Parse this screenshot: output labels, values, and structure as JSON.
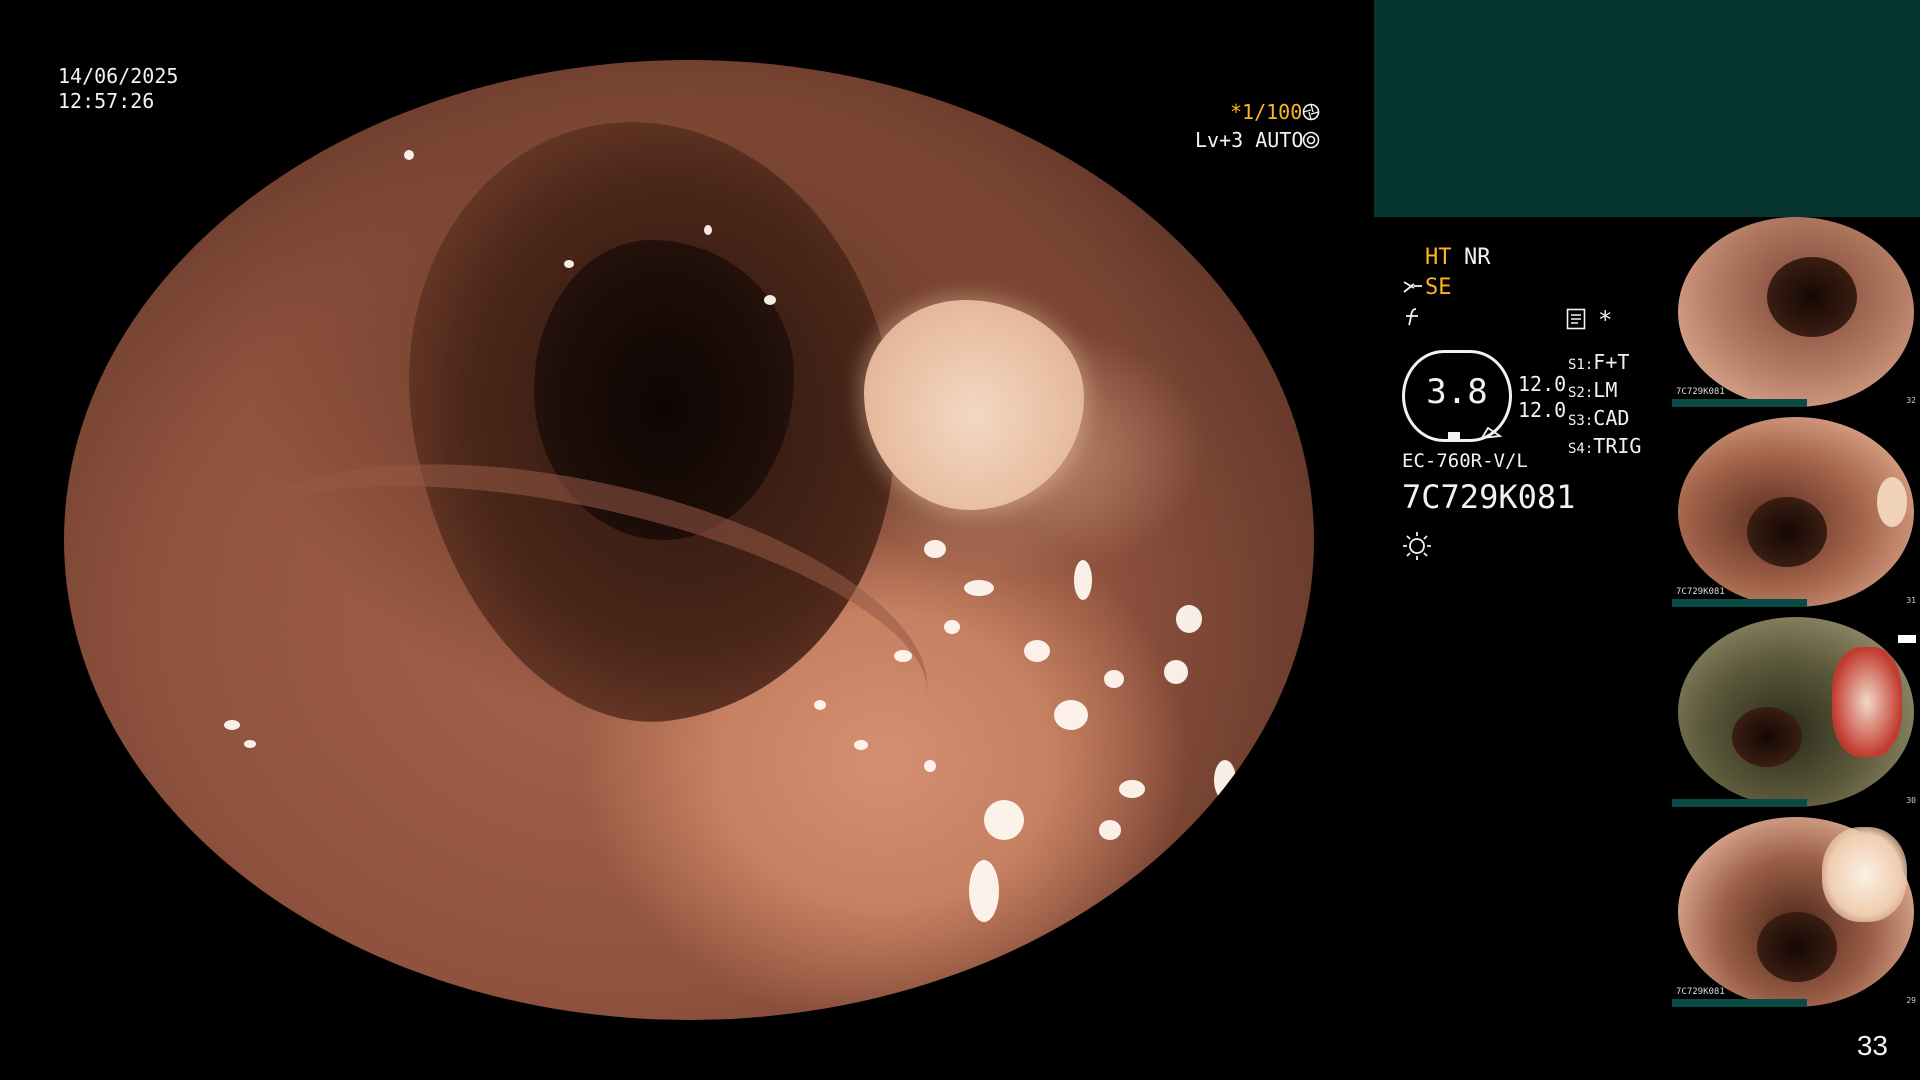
{
  "osd": {
    "date": "14/06/2025",
    "time": "12:57:26",
    "shutter": "*1/100",
    "level": "Lv+3 AUTO",
    "shutter_icon": "aperture-icon",
    "level_icon": "iris-icon"
  },
  "panel": {
    "ht": "HT",
    "nr": "NR",
    "se": "SE",
    "se_icon": "scissors-icon",
    "f_icon": "freeze-icon",
    "memo_icon": "memo-icon",
    "asterisk": "*",
    "zoom_value": "3.8",
    "val1": "12.0",
    "val2": "12.0",
    "switches": [
      {
        "key": "S1",
        "value": "F+T"
      },
      {
        "key": "S2",
        "value": "LM"
      },
      {
        "key": "S3",
        "value": "CAD"
      },
      {
        "key": "S4",
        "value": "TRIG"
      }
    ],
    "scope_model": "EC-760R-V/L",
    "serial": "7C729K081",
    "light_icon": "brightness-icon"
  },
  "thumbnails": [
    {
      "caption": "7C729K081",
      "number": "32"
    },
    {
      "caption": "7C729K081",
      "number": "31"
    },
    {
      "caption": "",
      "number": "30"
    },
    {
      "caption": "7C729K081",
      "number": "29"
    }
  ],
  "page_number": "33",
  "colors": {
    "accent_amber": "#ffb61e",
    "panel_teal": "#073530",
    "text": "#f2f2f2"
  }
}
